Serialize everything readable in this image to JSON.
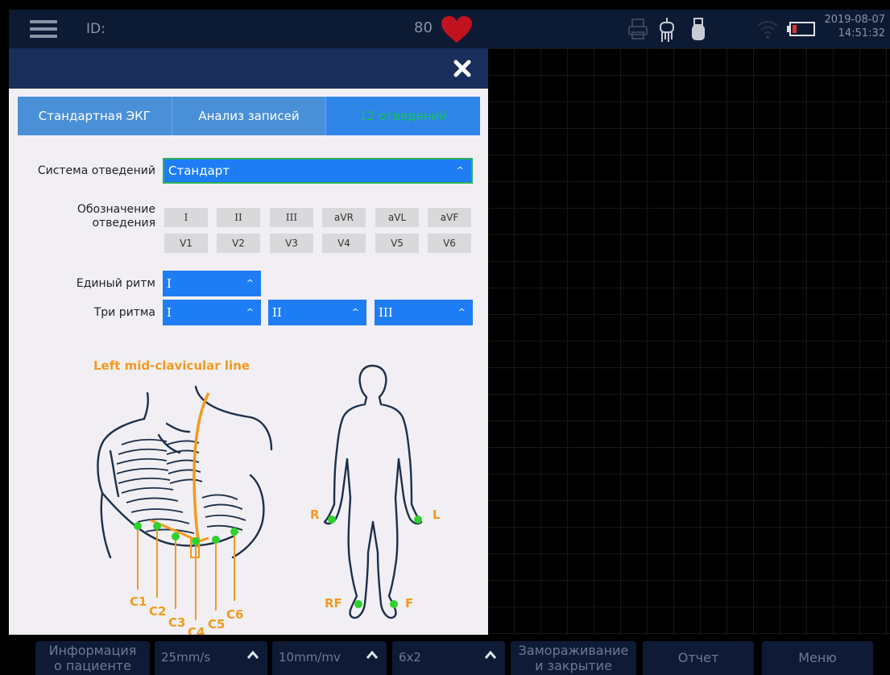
{
  "topbar": {
    "id_label": "ID:",
    "heart_rate": "80",
    "date": "2019-08-07",
    "time": "14:51:32"
  },
  "dialog": {
    "tabs": [
      {
        "label": "Стандартная ЭКГ",
        "active": false
      },
      {
        "label": "Анализ записей",
        "active": false
      },
      {
        "label": "12 отведений",
        "active": true
      }
    ],
    "lead_system": {
      "label": "Система отведений",
      "value": "Стандарт"
    },
    "lead_names": {
      "label_line1": "Обозначение",
      "label_line2": "отведения",
      "row1": [
        "I",
        "II",
        "III",
        "aVR",
        "aVL",
        "aVF"
      ],
      "row2": [
        "V1",
        "V2",
        "V3",
        "V4",
        "V5",
        "V6"
      ]
    },
    "single_rhythm": {
      "label": "Единый ритм",
      "value": "I"
    },
    "three_rhythm": {
      "label": "Три ритма",
      "values": [
        "I",
        "II",
        "III"
      ]
    },
    "diagram": {
      "title": "Left mid-clavicular line",
      "chest_leads": [
        "C1",
        "C2",
        "C3",
        "C4",
        "C5",
        "C6"
      ],
      "limb_leads": {
        "right_arm": "R",
        "left_arm": "L",
        "right_leg": "RF",
        "left_leg": "F"
      }
    }
  },
  "bottombar": {
    "patient_info": {
      "line1": "Информация",
      "line2": "о пациенте"
    },
    "speed": "25mm/s",
    "gain": "10mm/mv",
    "layout": "6x2",
    "freeze": {
      "line1": "Замораживание",
      "line2": "и закрытие"
    },
    "report": "Отчет",
    "menu": "Меню"
  },
  "colors": {
    "accent_blue": "#1e7df4",
    "active_tab_text": "#16c15a",
    "electrode_green": "#2fd12f",
    "diagram_orange": "#f39a1e",
    "heart_red": "#c0121f"
  }
}
